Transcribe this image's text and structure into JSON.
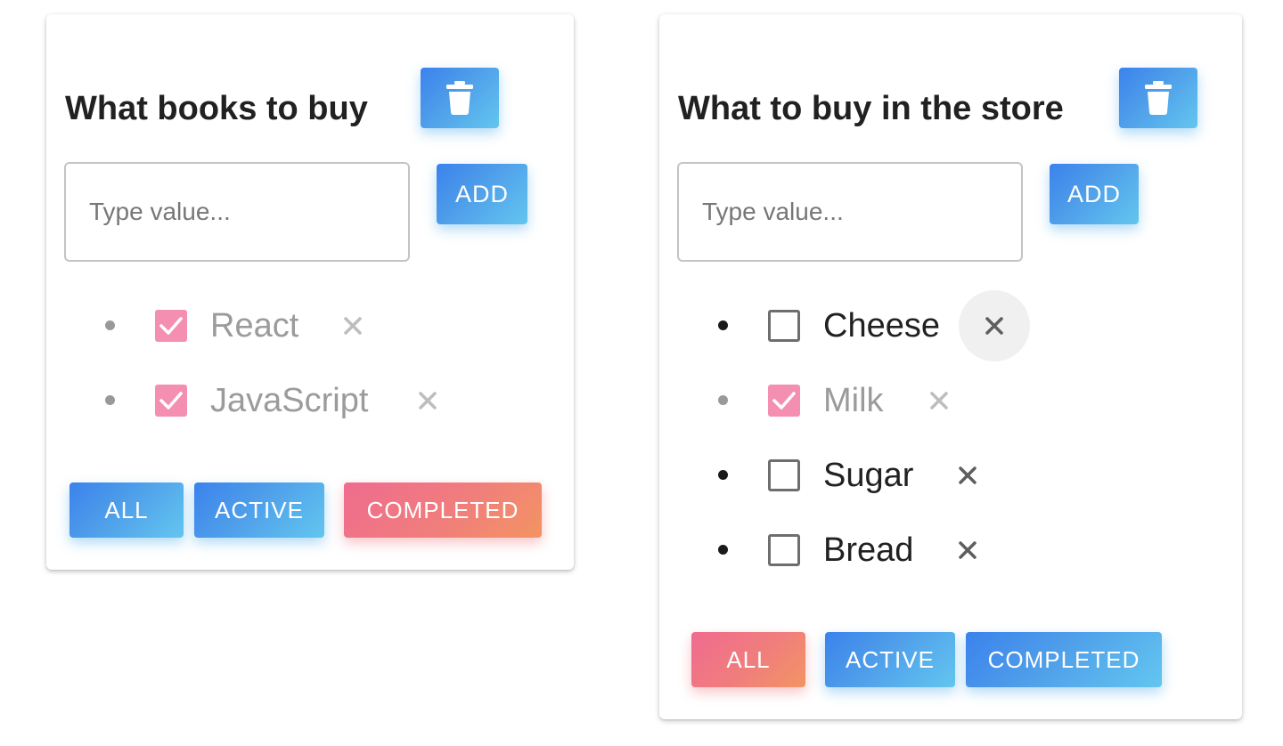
{
  "lists": [
    {
      "title": "What books to buy",
      "input": {
        "placeholder": "Type value...",
        "value": ""
      },
      "add_label": "ADD",
      "delete_icon": "trash-icon",
      "remove_icon": "close-icon",
      "tasks": [
        {
          "label": "React",
          "checked": true
        },
        {
          "label": "JavaScript",
          "checked": true
        }
      ],
      "filters": [
        {
          "label": "ALL",
          "active": false
        },
        {
          "label": "ACTIVE",
          "active": false
        },
        {
          "label": "COMPLETED",
          "active": true
        }
      ]
    },
    {
      "title": "What to buy in the store",
      "input": {
        "placeholder": "Type value...",
        "value": ""
      },
      "add_label": "ADD",
      "delete_icon": "trash-icon",
      "remove_icon": "close-icon",
      "tasks": [
        {
          "label": "Cheese",
          "checked": false
        },
        {
          "label": "Milk",
          "checked": true
        },
        {
          "label": "Sugar",
          "checked": false
        },
        {
          "label": "Bread",
          "checked": false
        }
      ],
      "filters": [
        {
          "label": "ALL",
          "active": true
        },
        {
          "label": "ACTIVE",
          "active": false
        },
        {
          "label": "COMPLETED",
          "active": false
        }
      ]
    }
  ],
  "colors": {
    "primary_gradient_start": "#3b82ec",
    "primary_gradient_end": "#63c6ef",
    "active_gradient_start": "#ef6b8f",
    "active_gradient_end": "#f39462",
    "checked_checkbox": "#f48fb1",
    "completed_text": "#9b9b9b"
  }
}
